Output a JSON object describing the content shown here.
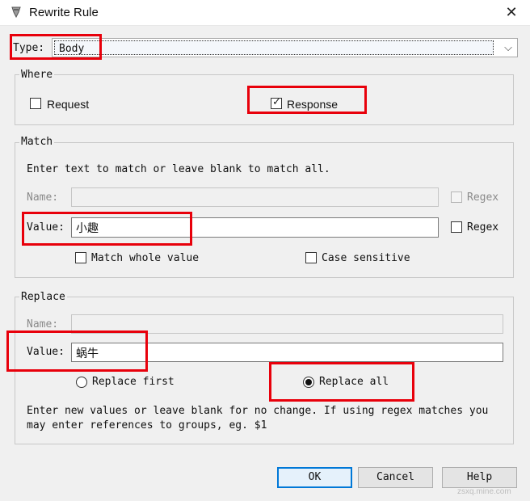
{
  "window": {
    "title": "Rewrite Rule",
    "close_glyph": "✕"
  },
  "type_row": {
    "label": "Type:",
    "selected": "Body",
    "chevron": "⌵"
  },
  "where": {
    "title": "Where",
    "request": {
      "label": "Request",
      "checked": false
    },
    "response": {
      "label": "Response",
      "checked": true
    }
  },
  "match": {
    "title": "Match",
    "instructions": "Enter text to match or leave blank to match all.",
    "name_label": "Name:",
    "name_value": "",
    "name_regex_label": "Regex",
    "value_label": "Value:",
    "value_value": "小趣",
    "value_regex_label": "Regex",
    "match_whole_label": "Match whole value",
    "case_sensitive_label": "Case sensitive"
  },
  "replace": {
    "title": "Replace",
    "name_label": "Name:",
    "name_value": "",
    "value_label": "Value:",
    "value_value": "蜗牛",
    "replace_first_label": "Replace first",
    "replace_all_label": "Replace all",
    "selected": "replace_all",
    "note_line1": "Enter new values or leave blank for no change. If using regex matches you",
    "note_line2": "may enter references to groups, eg. $1"
  },
  "buttons": {
    "ok": "OK",
    "cancel": "Cancel",
    "help": "Help"
  },
  "annotation_color": "#e8000b",
  "watermark": "zsxq.mine.com"
}
